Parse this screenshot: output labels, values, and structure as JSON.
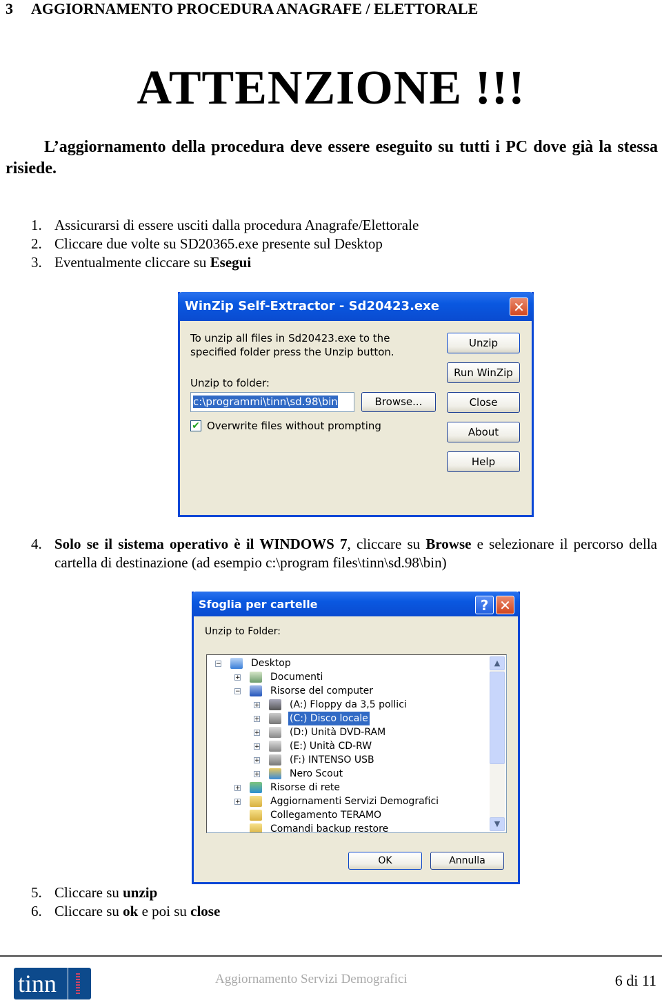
{
  "header": {
    "section_number": "3",
    "section_title": "AGGIORNAMENTO PROCEDURA ANAGRAFE / ELETTORALE"
  },
  "warning": {
    "title": "ATTENZIONE !!!",
    "text": "L’aggiornamento della procedura deve essere eseguito su tutti i PC dove già la stessa risiede."
  },
  "steps_a": [
    {
      "n": "1.",
      "text": "Assicurarsi di essere usciti dalla procedura Anagrafe/Elettorale"
    },
    {
      "n": "2.",
      "text": "Cliccare due volte su SD20365.exe presente sul Desktop"
    },
    {
      "n": "3.",
      "pre": "Eventualmente cliccare su ",
      "bold": "Esegui"
    }
  ],
  "winzip": {
    "title": "WinZip Self-Extractor - Sd20423.exe",
    "instructions": "To unzip all files in Sd20423.exe to the specified folder press the Unzip button.",
    "folder_label": "Unzip to folder:",
    "folder_value": "c:\\programmi\\tinn\\sd.98\\bin",
    "browse": "Browse...",
    "overwrite": "Overwrite files without prompting",
    "overwrite_checked": true,
    "buttons": [
      "Unzip",
      "Run WinZip",
      "Close",
      "About",
      "Help"
    ],
    "close_icon": "close-icon"
  },
  "step4": {
    "n": "4.",
    "parts": [
      {
        "b": true,
        "t": "Solo se il sistema operativo è il WINDOWS 7"
      },
      {
        "b": false,
        "t": ", cliccare su "
      },
      {
        "b": true,
        "t": "Browse"
      },
      {
        "b": false,
        "t": " e selezionare il percorso della cartella di destinazione (ad esempio c:\\program files\\tinn\\sd.98\\bin)"
      }
    ]
  },
  "browse_dialog": {
    "title": "Sfoglia per cartelle",
    "label": "Unzip to Folder:",
    "tree": [
      {
        "level": 0,
        "exp": "-",
        "icon": "desktop",
        "label": "Desktop"
      },
      {
        "level": 1,
        "exp": "+",
        "icon": "documents",
        "label": "Documenti"
      },
      {
        "level": 1,
        "exp": "-",
        "icon": "computer",
        "label": "Risorse del computer"
      },
      {
        "level": 2,
        "exp": "+",
        "icon": "floppy",
        "label": "(A:) Floppy da 3,5 pollici"
      },
      {
        "level": 2,
        "exp": "+",
        "icon": "drive",
        "label": "(C:) Disco locale",
        "selected": true
      },
      {
        "level": 2,
        "exp": "+",
        "icon": "cd",
        "label": "(D:) Unità DVD-RAM"
      },
      {
        "level": 2,
        "exp": "+",
        "icon": "cd",
        "label": "(E:) Unità CD-RW"
      },
      {
        "level": 2,
        "exp": "+",
        "icon": "drive",
        "label": "(F:) INTENSO USB"
      },
      {
        "level": 2,
        "exp": "+",
        "icon": "nero",
        "label": "Nero Scout"
      },
      {
        "level": 1,
        "exp": "+",
        "icon": "network",
        "label": "Risorse di rete"
      },
      {
        "level": 1,
        "exp": "+",
        "icon": "folder",
        "label": "Aggiornamenti Servizi Demografici"
      },
      {
        "level": 1,
        "exp": "",
        "icon": "folder",
        "label": "Collegamento TERAMO"
      },
      {
        "level": 1,
        "exp": "",
        "icon": "folder",
        "label": "Comandi backup restore"
      }
    ],
    "ok": "OK",
    "cancel": "Annulla"
  },
  "steps_b": [
    {
      "n": "5.",
      "pre": "Cliccare su ",
      "bold": "unzip",
      "post": ""
    },
    {
      "n": "6.",
      "pre": "Cliccare su ",
      "bold": "ok",
      "mid": " e poi su ",
      "bold2": "close"
    }
  ],
  "footer": {
    "logo": "tinn",
    "center": "Aggiornamento Servizi Demografici",
    "page": "6 di 11"
  },
  "colors": {
    "titlebar": "#0a58e0",
    "dialog_bg": "#ece9d8",
    "selection": "#316ac5",
    "logo": "#0d4a8c"
  }
}
